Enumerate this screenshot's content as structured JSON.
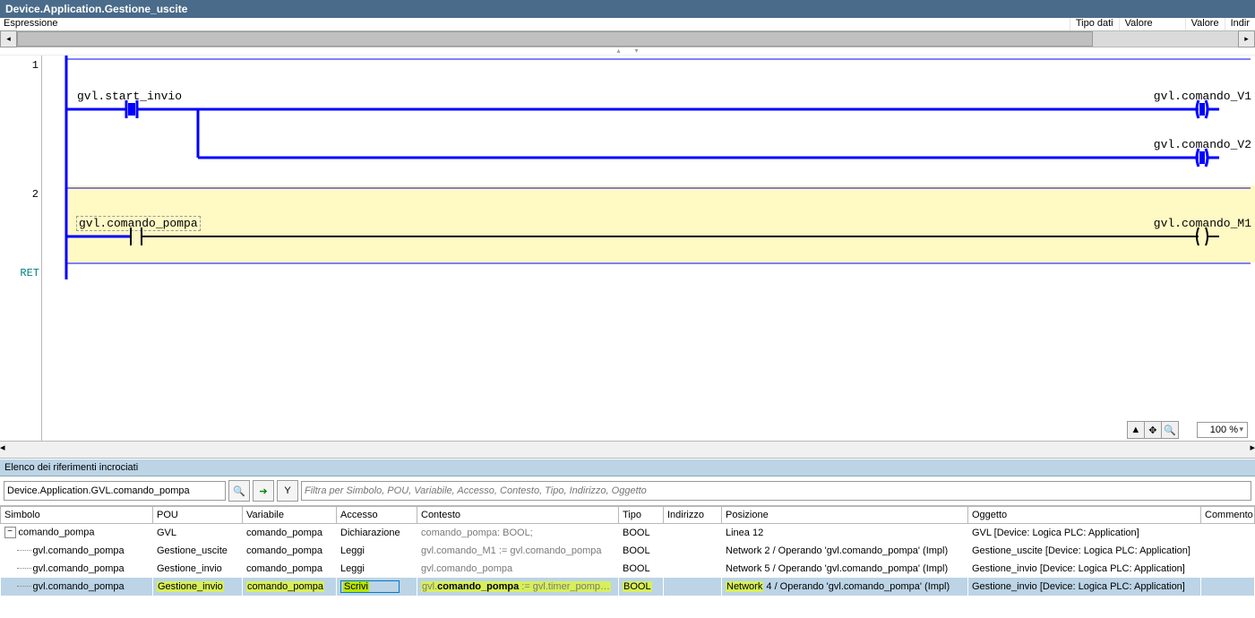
{
  "title": "Device.Application.Gestione_uscite",
  "decl": {
    "expr": "Espressione",
    "type": "Tipo dati",
    "value": "Valore",
    "prepared": "Valore",
    "address": "Indir"
  },
  "ladder": {
    "rung1": {
      "num": "1",
      "contact": "gvl.start_invio",
      "coil1": "gvl.comando_V1",
      "coil2": "gvl.comando_V2"
    },
    "rung2": {
      "num": "2",
      "contact": "gvl.comando_pompa",
      "coil1": "gvl.comando_M1"
    },
    "ret": "RET"
  },
  "zoom": "100 %",
  "xref": {
    "panel_title": "Elenco dei riferimenti incrociati",
    "search_value": "Device.Application.GVL.comando_pompa",
    "filter_placeholder": "Filtra per Simbolo, POU, Variabile, Accesso, Contesto, Tipo, Indirizzo, Oggetto",
    "headers": {
      "symbol": "Simbolo",
      "pou": "POU",
      "variable": "Variabile",
      "access": "Accesso",
      "context": "Contesto",
      "type": "Tipo",
      "address": "Indirizzo",
      "position": "Posizione",
      "object": "Oggetto",
      "comment": "Commento"
    },
    "rows": [
      {
        "symbol": "comando_pompa",
        "pou": "GVL",
        "variable": "comando_pompa",
        "access": "Dichiarazione",
        "context_plain": "comando_pompa: BOOL;",
        "type": "BOOL",
        "address": "",
        "position": "Linea 12",
        "object": "GVL [Device: Logica PLC: Application]",
        "indent": 0,
        "expander": true
      },
      {
        "symbol": "gvl.comando_pompa",
        "pou": "Gestione_uscite",
        "variable": "comando_pompa",
        "access": "Leggi",
        "context_plain": "gvl.comando_M1 := gvl.comando_pompa",
        "type": "BOOL",
        "address": "",
        "position": "Network 2 / Operando 'gvl.comando_pompa' (Impl)",
        "object": "Gestione_uscite [Device: Logica PLC: Application]",
        "indent": 1
      },
      {
        "symbol": "gvl.comando_pompa",
        "pou": "Gestione_invio",
        "variable": "comando_pompa",
        "access": "Leggi",
        "context_plain": "gvl.comando_pompa",
        "type": "BOOL",
        "address": "",
        "position": "Network 5 / Operando 'gvl.comando_pompa' (Impl)",
        "object": "Gestione_invio [Device: Logica PLC: Application]",
        "indent": 1
      },
      {
        "symbol": "gvl.comando_pompa",
        "pou": "Gestione_invio",
        "variable": "comando_pompa",
        "access": "Scrivi",
        "context_rich": "<span>gvl.</span><b>comando_pompa</b> := gvl.timer_pomp…",
        "type": "BOOL",
        "address": "",
        "position": "Network 4 / Operando 'gvl.comando_pompa' (Impl)",
        "object": "Gestione_invio [Device: Logica PLC: Application]",
        "indent": 1,
        "selected": true,
        "hl": true,
        "write": true
      }
    ]
  }
}
